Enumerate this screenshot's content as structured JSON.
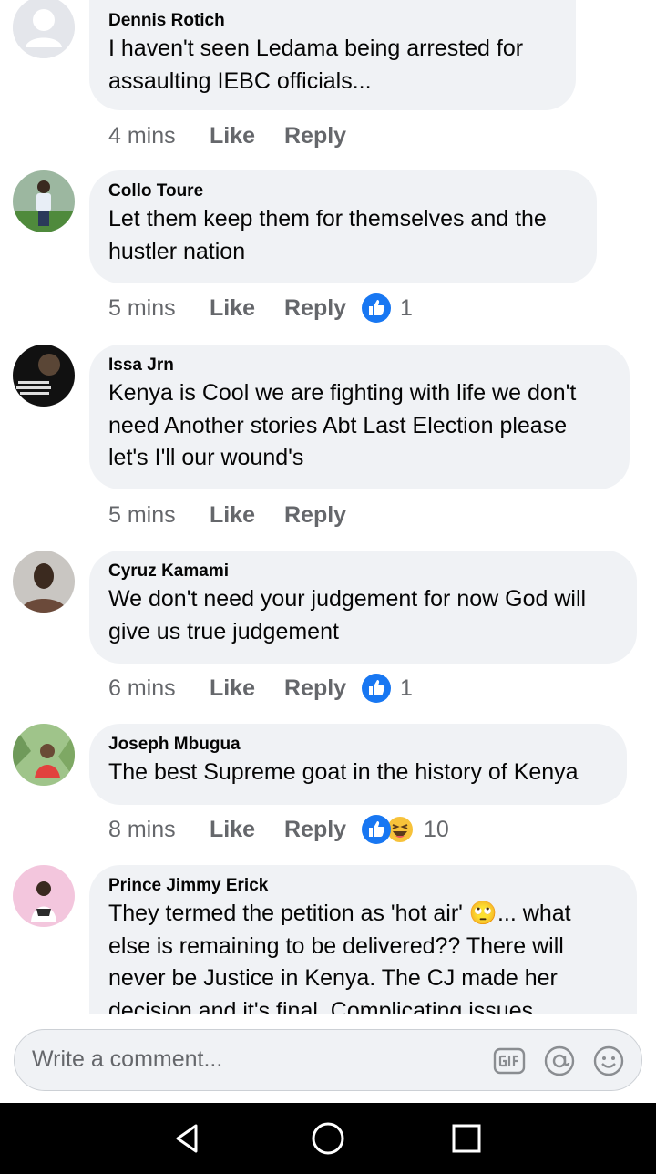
{
  "comments": [
    {
      "author": "Dennis Rotich",
      "lines": [
        "I haven't seen Ledama  being arrested for",
        "assaulting IEBC officials..."
      ],
      "time": "4 mins",
      "like": "Like",
      "reply": "Reply",
      "avatar": "default-avatar-icon"
    },
    {
      "author": "Collo Toure",
      "lines": [
        "Let them keep them for themselves and the",
        "hustler nation"
      ],
      "time": "5 mins",
      "like": "Like",
      "reply": "Reply",
      "reaction_count": "1",
      "reactions": [
        "like-icon"
      ],
      "avatar": "profile-photo"
    },
    {
      "author": "Issa Jrn",
      "lines": [
        "Kenya is Cool we are fighting with life we don't",
        "need Another stories Abt Last Election please",
        "let's I'll our wound's"
      ],
      "time": "5 mins",
      "like": "Like",
      "reply": "Reply",
      "avatar": "profile-photo"
    },
    {
      "author": "Cyruz Kamami",
      "lines": [
        "We don't need your judgement for now God will",
        "give us true judgement"
      ],
      "time": "6 mins",
      "like": "Like",
      "reply": "Reply",
      "reaction_count": "1",
      "reactions": [
        "like-icon"
      ],
      "avatar": "profile-photo"
    },
    {
      "author": "Joseph Mbugua",
      "lines": [
        "The best Supreme goat in the history of Kenya"
      ],
      "time": "8 mins",
      "like": "Like",
      "reply": "Reply",
      "reaction_count": "10",
      "reactions": [
        "like-icon",
        "haha-icon"
      ],
      "avatar": "profile-photo"
    },
    {
      "author": "Prince Jimmy Erick",
      "lines": [
        "They termed the petition as 'hot air' 🙄... what",
        "else is remaining to be delivered?? There will",
        "never be Justice in Kenya. The CJ made her",
        "decision and it's final. Complicating issues"
      ],
      "avatar": "profile-photo"
    }
  ],
  "composer": {
    "placeholder": "Write a comment...",
    "icons": [
      "gif-icon",
      "mention-icon",
      "emoji-icon"
    ]
  },
  "nav": {
    "icons": [
      "back-icon",
      "home-icon",
      "recents-icon"
    ]
  },
  "colors": {
    "bubble": "#f0f2f5",
    "meta_text": "#65676b",
    "like_blue": "#1877f2",
    "nav_bar": "#000000"
  }
}
